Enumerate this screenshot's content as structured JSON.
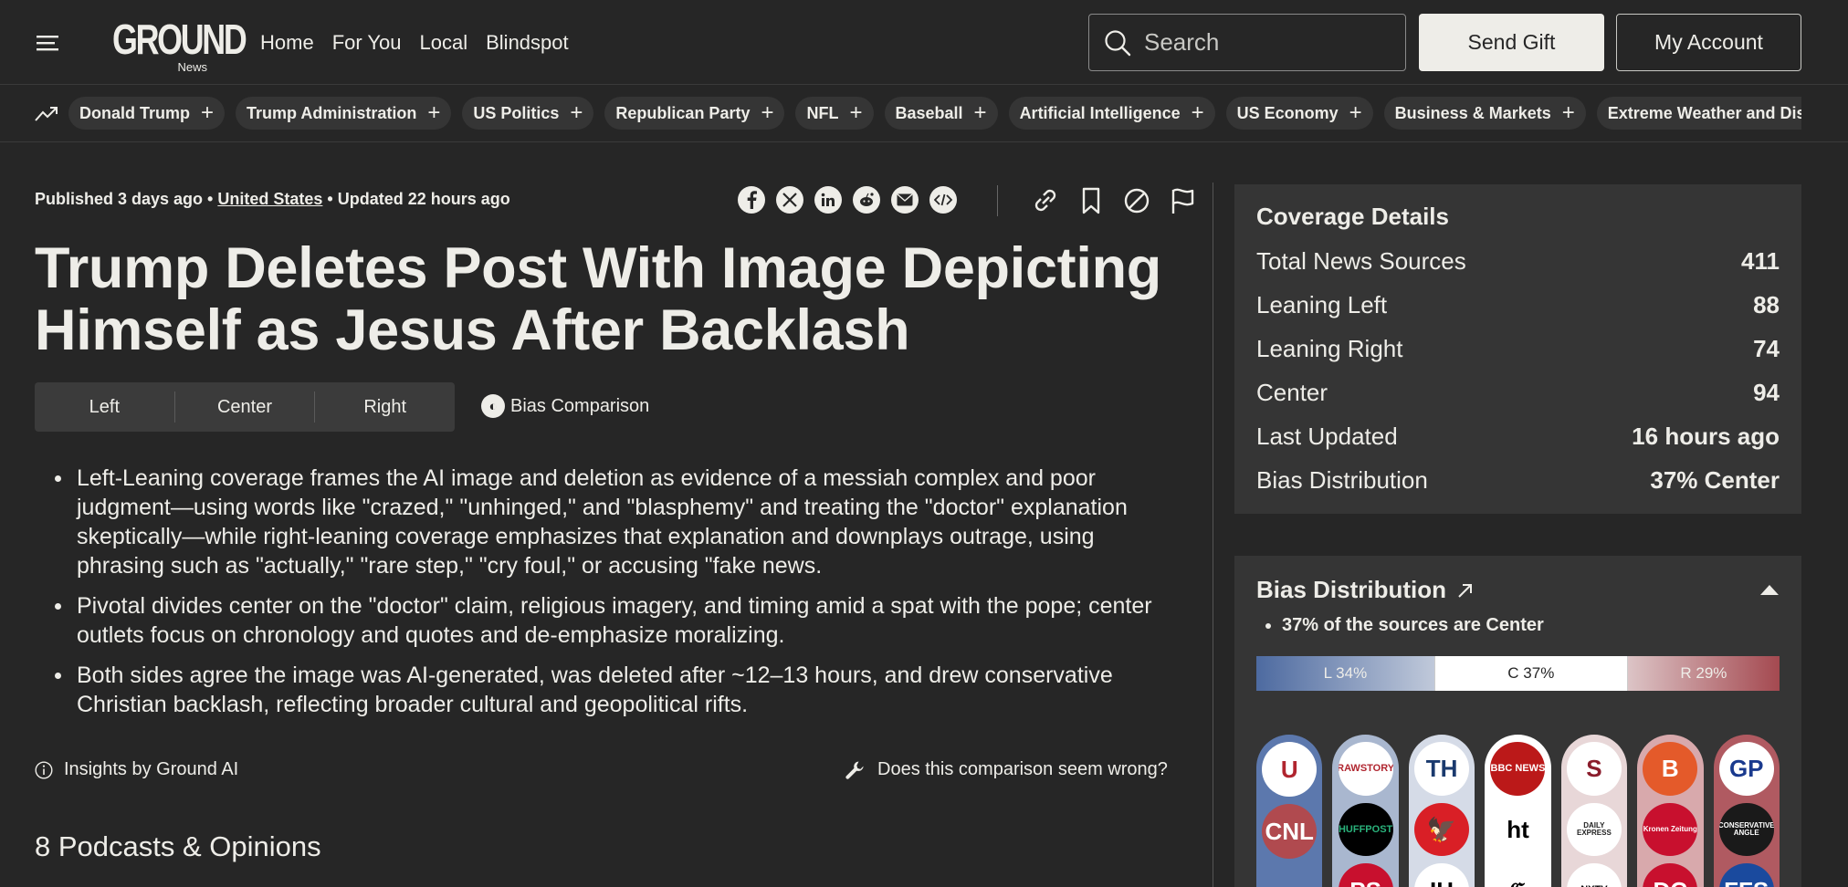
{
  "header": {
    "logo_text": "GROUND",
    "logo_sub": "News",
    "nav": [
      "Home",
      "For You",
      "Local",
      "Blindspot"
    ],
    "search_placeholder": "Search",
    "send_gift": "Send Gift",
    "my_account": "My Account"
  },
  "topics": [
    "Donald Trump",
    "Trump Administration",
    "US Politics",
    "Republican Party",
    "NFL",
    "Baseball",
    "Artificial Intelligence",
    "US Economy",
    "Business & Markets",
    "Extreme Weather and Disasters"
  ],
  "article": {
    "published": "Published 3 days ago •",
    "location": "United States",
    "updated": "• Updated 22 hours ago",
    "title": "Trump Deletes Post With Image Depicting Himself as Jesus After Backlash",
    "bias_tabs": [
      "Left",
      "Center",
      "Right"
    ],
    "bias_comparison": "Bias Comparison",
    "bullets": [
      "Left-Leaning coverage frames the AI image and deletion as evidence of a messiah complex and poor judgment—using words like \"crazed,\" \"unhinged,\" and \"blasphemy\" and treating the \"doctor\" explanation skeptically—while right-leaning coverage emphasizes that explanation and downplays outrage, using phrasing such as \"actually,\" \"rare step,\" \"cry foul,\" or accusing \"fake news.",
      "Pivotal divides center on the \"doctor\" claim, religious imagery, and timing amid a spat with the pope; center outlets focus on chronology and quotes and de-emphasize moralizing.",
      "Both sides agree the image was AI-generated, was deleted after ~12–13 hours, and drew conservative Christian backlash, reflecting broader cultural and geopolitical rifts."
    ],
    "insights": "Insights by Ground AI",
    "wrong": "Does this comparison seem wrong?",
    "podcasts_heading": "8 Podcasts & Opinions"
  },
  "coverage": {
    "title": "Coverage Details",
    "rows": [
      {
        "label": "Total News Sources",
        "value": "411"
      },
      {
        "label": "Leaning Left",
        "value": "88"
      },
      {
        "label": "Leaning Right",
        "value": "74"
      },
      {
        "label": "Center",
        "value": "94"
      },
      {
        "label": "Last Updated",
        "value": "16 hours ago"
      },
      {
        "label": "Bias Distribution",
        "value": "37% Center"
      }
    ]
  },
  "bias_distribution": {
    "title": "Bias Distribution",
    "summary": "37% of the sources are Center",
    "left_label": "L 34%",
    "center_label": "C 37%",
    "right_label": "R 29%",
    "left_pct": 34,
    "center_pct": 37,
    "right_pct": 29,
    "columns": [
      {
        "bg": "#5c78ad",
        "logos": [
          {
            "text": "U",
            "bg": "#ffffff",
            "fg": "#b0252f"
          },
          {
            "text": "CNL",
            "bg": "#b04a4f",
            "fg": "#ffffff"
          }
        ]
      },
      {
        "bg": "#a9b7cf",
        "logos": [
          {
            "text": "RAWSTORY",
            "bg": "#ffffff",
            "fg": "#b0252f"
          },
          {
            "text": "HUFFPOST",
            "bg": "#000000",
            "fg": "#2ab27b"
          },
          {
            "text": "PS",
            "bg": "#c8102e",
            "fg": "#ffffff"
          }
        ]
      },
      {
        "bg": "#d5dbe7",
        "logos": [
          {
            "text": "TH",
            "bg": "#ffffff",
            "fg": "#1a3a6e"
          },
          {
            "text": "🦅",
            "bg": "#d91f26",
            "fg": "#ffffff"
          },
          {
            "text": "IH",
            "bg": "#ffffff",
            "fg": "#000000"
          }
        ]
      },
      {
        "bg": "#ffffff",
        "logos": [
          {
            "text": "BBC NEWS",
            "bg": "#bb1919",
            "fg": "#ffffff"
          },
          {
            "text": "ht",
            "bg": "#ffffff",
            "fg": "#000000"
          },
          {
            "text": "𝔊",
            "bg": "#ffffff",
            "fg": "#000000"
          }
        ]
      },
      {
        "bg": "#e8d7d8",
        "logos": [
          {
            "text": "S",
            "bg": "#ffffff",
            "fg": "#8a1c2b"
          },
          {
            "text": "DAILY EXPRESS",
            "bg": "#ffffff",
            "fg": "#222222"
          },
          {
            "text": "NYTV",
            "bg": "#ffffff",
            "fg": "#000000"
          }
        ]
      },
      {
        "bg": "#d8a9ac",
        "logos": [
          {
            "text": "B",
            "bg": "#e45a2a",
            "fg": "#ffffff"
          },
          {
            "text": "Kronen Zeitung",
            "bg": "#c8102e",
            "fg": "#ffffff"
          },
          {
            "text": "DC",
            "bg": "#c8102e",
            "fg": "#ffffff"
          }
        ]
      },
      {
        "bg": "#b05a61",
        "logos": [
          {
            "text": "GP",
            "bg": "#ffffff",
            "fg": "#1a3a8e"
          },
          {
            "text": "CONSERVATIVE ANGLE",
            "bg": "#1a1a1a",
            "fg": "#ffffff"
          },
          {
            "text": "FFS",
            "bg": "#1a4a9e",
            "fg": "#ffffff"
          }
        ]
      }
    ]
  },
  "colors": {
    "background": "#262626",
    "panel": "#353535",
    "text": "#eeede8",
    "left": "#4d6aa0",
    "right": "#a44950"
  }
}
